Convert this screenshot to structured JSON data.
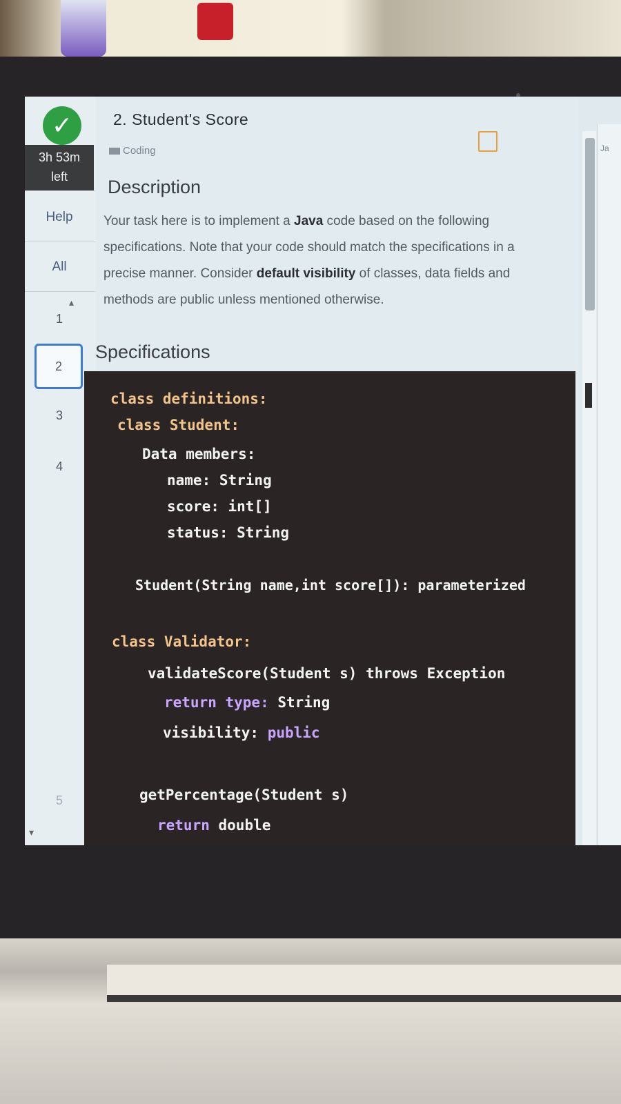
{
  "sidebar": {
    "status_icon": "check-circle-icon",
    "timer_line1": "3h 53m",
    "timer_line2": "left",
    "help_label": "Help",
    "all_label": "All",
    "questions": [
      "1",
      "2",
      "3",
      "4",
      "5"
    ],
    "active_question": "2"
  },
  "question": {
    "title": "2. Student's Score",
    "tag": "Coding",
    "bookmark_icon": "bookmark-icon",
    "description_heading": "Description",
    "description_parts": {
      "p1": "Your task here is to implement a ",
      "java": "Java",
      "p2": " code based on the following specifications. Note that your code should match the specifications in a precise manner. Consider ",
      "default_vis": "default visibility",
      "p3": " of classes, data fields and methods are public unless mentioned otherwise."
    },
    "specifications_heading": "Specifications"
  },
  "code": {
    "l1": "class definitions:",
    "l2": "class Student:",
    "l3": "Data members:",
    "l4": "name: String",
    "l5": "score: int[]",
    "l6": "status: String",
    "l7": "Student(String name,int score[]): parameterized",
    "l8": "class Validator:",
    "l9": "validateScore(Student s) throws Exception",
    "l10a": "return type: ",
    "l10b": "String",
    "l11a": "visibility: ",
    "l11b": "public",
    "l12": "getPercentage(Student s)",
    "l13a": "return ",
    "l13b": "double"
  },
  "right_panel": {
    "tab_label": "Ja"
  },
  "colors": {
    "accent": "#3d7bd9",
    "success": "#2ea043",
    "code_bg": "#2a2424",
    "keyword_yellow": "#f3c58a",
    "keyword_purple": "#c9a6ff",
    "bookmark": "#e7a03a"
  }
}
